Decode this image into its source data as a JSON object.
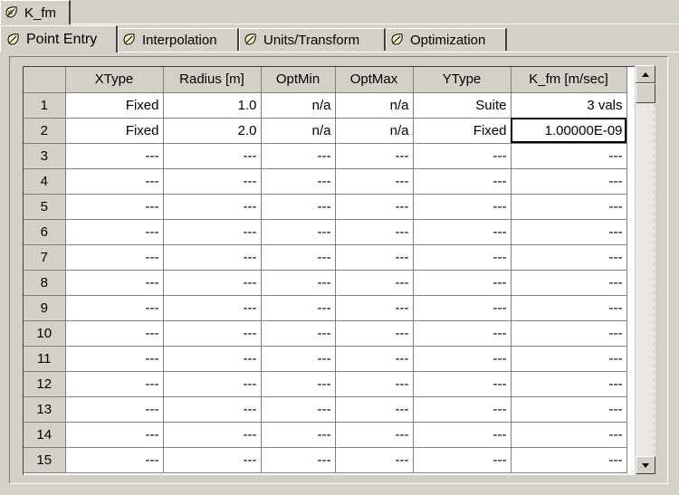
{
  "top_tab": {
    "label": "K_fm",
    "icon": "leaf-icon"
  },
  "sub_tabs": [
    {
      "label": "Point Entry",
      "icon": "leaf-icon",
      "active": true
    },
    {
      "label": "Interpolation",
      "icon": "leaf-icon",
      "active": false
    },
    {
      "label": "Units/Transform",
      "icon": "leaf-icon",
      "active": false
    },
    {
      "label": "Optimization",
      "icon": "leaf-icon",
      "active": false
    }
  ],
  "grid": {
    "columns": [
      "XType",
      "Radius [m]",
      "OptMin",
      "OptMax",
      "YType",
      "K_fm [m/sec]"
    ],
    "rows": [
      {
        "num": "1",
        "cells": [
          "Fixed",
          "1.0",
          "n/a",
          "n/a",
          "Suite",
          "3 vals"
        ]
      },
      {
        "num": "2",
        "cells": [
          "Fixed",
          "2.0",
          "n/a",
          "n/a",
          "Fixed",
          "1.00000E-09"
        ]
      },
      {
        "num": "3",
        "cells": [
          "---",
          "---",
          "---",
          "---",
          "---",
          "---"
        ]
      },
      {
        "num": "4",
        "cells": [
          "---",
          "---",
          "---",
          "---",
          "---",
          "---"
        ]
      },
      {
        "num": "5",
        "cells": [
          "---",
          "---",
          "---",
          "---",
          "---",
          "---"
        ]
      },
      {
        "num": "6",
        "cells": [
          "---",
          "---",
          "---",
          "---",
          "---",
          "---"
        ]
      },
      {
        "num": "7",
        "cells": [
          "---",
          "---",
          "---",
          "---",
          "---",
          "---"
        ]
      },
      {
        "num": "8",
        "cells": [
          "---",
          "---",
          "---",
          "---",
          "---",
          "---"
        ]
      },
      {
        "num": "9",
        "cells": [
          "---",
          "---",
          "---",
          "---",
          "---",
          "---"
        ]
      },
      {
        "num": "10",
        "cells": [
          "---",
          "---",
          "---",
          "---",
          "---",
          "---"
        ]
      },
      {
        "num": "11",
        "cells": [
          "---",
          "---",
          "---",
          "---",
          "---",
          "---"
        ]
      },
      {
        "num": "12",
        "cells": [
          "---",
          "---",
          "---",
          "---",
          "---",
          "---"
        ]
      },
      {
        "num": "13",
        "cells": [
          "---",
          "---",
          "---",
          "---",
          "---",
          "---"
        ]
      },
      {
        "num": "14",
        "cells": [
          "---",
          "---",
          "---",
          "---",
          "---",
          "---"
        ]
      },
      {
        "num": "15",
        "cells": [
          "---",
          "---",
          "---",
          "---",
          "---",
          "---"
        ]
      }
    ],
    "selected_cell": {
      "row": 1,
      "col": 5
    }
  },
  "scrollbar": {
    "up_icon": "arrow-up-icon",
    "down_icon": "arrow-down-icon"
  }
}
